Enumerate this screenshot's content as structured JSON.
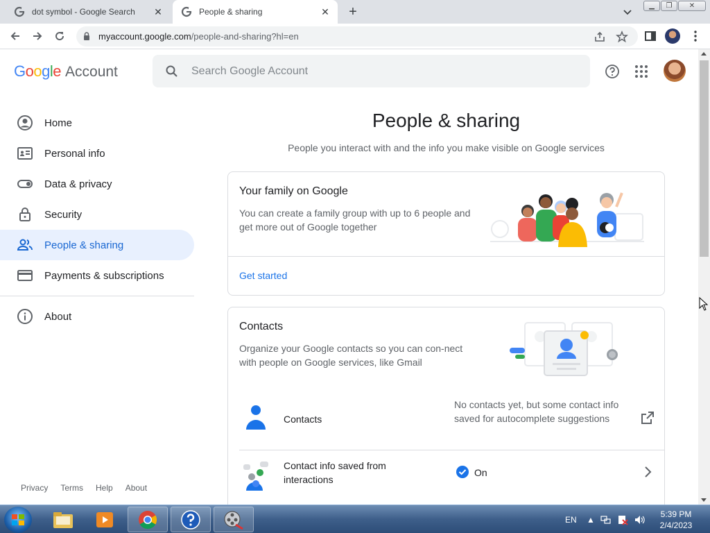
{
  "browser": {
    "tabs": [
      {
        "title": "dot symbol - Google Search",
        "active": false
      },
      {
        "title": "People & sharing",
        "active": true
      }
    ],
    "url_host": "myaccount.google.com",
    "url_path": "/people-and-sharing?hl=en"
  },
  "header": {
    "logo_google": "Google",
    "logo_account": "Account",
    "search_placeholder": "Search Google Account"
  },
  "nav": {
    "items": [
      {
        "label": "Home",
        "icon": "account-circle-icon"
      },
      {
        "label": "Personal info",
        "icon": "id-card-icon"
      },
      {
        "label": "Data & privacy",
        "icon": "toggle-icon"
      },
      {
        "label": "Security",
        "icon": "lock-icon"
      },
      {
        "label": "People & sharing",
        "icon": "people-icon",
        "active": true
      },
      {
        "label": "Payments & subscriptions",
        "icon": "credit-card-icon"
      }
    ],
    "about": "About"
  },
  "footer": {
    "links": [
      "Privacy",
      "Terms",
      "Help",
      "About"
    ]
  },
  "main": {
    "title": "People & sharing",
    "subtitle": "People you interact with and the info you make visible on Google services",
    "family_card": {
      "title": "Your family on Google",
      "description": "You can create a family group with up to 6 people and get more out of Google together",
      "link": "Get started"
    },
    "contacts_card": {
      "title": "Contacts",
      "description": "Organize your Google contacts so you can con-nect with people on Google services, like Gmail",
      "rows": [
        {
          "label": "Contacts",
          "status": "No contacts yet, but some contact info saved for autocomplete suggestions"
        },
        {
          "label": "Contact info saved from interactions",
          "status": "On"
        }
      ]
    }
  },
  "taskbar": {
    "lang": "EN",
    "time": "5:39 PM",
    "date": "2/4/2023"
  },
  "colors": {
    "accent": "#1a73e8",
    "active_nav_bg": "#e8f0fe"
  }
}
